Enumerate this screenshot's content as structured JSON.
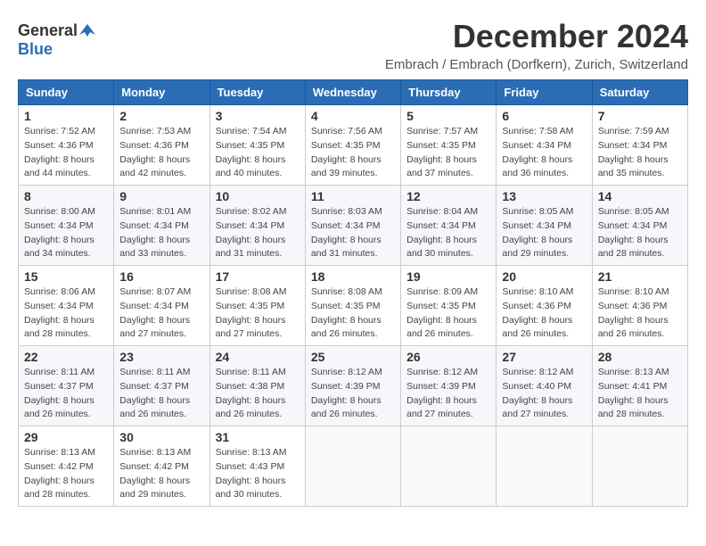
{
  "header": {
    "logo_general": "General",
    "logo_blue": "Blue",
    "month_title": "December 2024",
    "subtitle": "Embrach / Embrach (Dorfkern), Zurich, Switzerland"
  },
  "days_of_week": [
    "Sunday",
    "Monday",
    "Tuesday",
    "Wednesday",
    "Thursday",
    "Friday",
    "Saturday"
  ],
  "weeks": [
    [
      {
        "day": "1",
        "sunrise": "Sunrise: 7:52 AM",
        "sunset": "Sunset: 4:36 PM",
        "daylight": "Daylight: 8 hours and 44 minutes."
      },
      {
        "day": "2",
        "sunrise": "Sunrise: 7:53 AM",
        "sunset": "Sunset: 4:36 PM",
        "daylight": "Daylight: 8 hours and 42 minutes."
      },
      {
        "day": "3",
        "sunrise": "Sunrise: 7:54 AM",
        "sunset": "Sunset: 4:35 PM",
        "daylight": "Daylight: 8 hours and 40 minutes."
      },
      {
        "day": "4",
        "sunrise": "Sunrise: 7:56 AM",
        "sunset": "Sunset: 4:35 PM",
        "daylight": "Daylight: 8 hours and 39 minutes."
      },
      {
        "day": "5",
        "sunrise": "Sunrise: 7:57 AM",
        "sunset": "Sunset: 4:35 PM",
        "daylight": "Daylight: 8 hours and 37 minutes."
      },
      {
        "day": "6",
        "sunrise": "Sunrise: 7:58 AM",
        "sunset": "Sunset: 4:34 PM",
        "daylight": "Daylight: 8 hours and 36 minutes."
      },
      {
        "day": "7",
        "sunrise": "Sunrise: 7:59 AM",
        "sunset": "Sunset: 4:34 PM",
        "daylight": "Daylight: 8 hours and 35 minutes."
      }
    ],
    [
      {
        "day": "8",
        "sunrise": "Sunrise: 8:00 AM",
        "sunset": "Sunset: 4:34 PM",
        "daylight": "Daylight: 8 hours and 34 minutes."
      },
      {
        "day": "9",
        "sunrise": "Sunrise: 8:01 AM",
        "sunset": "Sunset: 4:34 PM",
        "daylight": "Daylight: 8 hours and 33 minutes."
      },
      {
        "day": "10",
        "sunrise": "Sunrise: 8:02 AM",
        "sunset": "Sunset: 4:34 PM",
        "daylight": "Daylight: 8 hours and 31 minutes."
      },
      {
        "day": "11",
        "sunrise": "Sunrise: 8:03 AM",
        "sunset": "Sunset: 4:34 PM",
        "daylight": "Daylight: 8 hours and 31 minutes."
      },
      {
        "day": "12",
        "sunrise": "Sunrise: 8:04 AM",
        "sunset": "Sunset: 4:34 PM",
        "daylight": "Daylight: 8 hours and 30 minutes."
      },
      {
        "day": "13",
        "sunrise": "Sunrise: 8:05 AM",
        "sunset": "Sunset: 4:34 PM",
        "daylight": "Daylight: 8 hours and 29 minutes."
      },
      {
        "day": "14",
        "sunrise": "Sunrise: 8:05 AM",
        "sunset": "Sunset: 4:34 PM",
        "daylight": "Daylight: 8 hours and 28 minutes."
      }
    ],
    [
      {
        "day": "15",
        "sunrise": "Sunrise: 8:06 AM",
        "sunset": "Sunset: 4:34 PM",
        "daylight": "Daylight: 8 hours and 28 minutes."
      },
      {
        "day": "16",
        "sunrise": "Sunrise: 8:07 AM",
        "sunset": "Sunset: 4:34 PM",
        "daylight": "Daylight: 8 hours and 27 minutes."
      },
      {
        "day": "17",
        "sunrise": "Sunrise: 8:08 AM",
        "sunset": "Sunset: 4:35 PM",
        "daylight": "Daylight: 8 hours and 27 minutes."
      },
      {
        "day": "18",
        "sunrise": "Sunrise: 8:08 AM",
        "sunset": "Sunset: 4:35 PM",
        "daylight": "Daylight: 8 hours and 26 minutes."
      },
      {
        "day": "19",
        "sunrise": "Sunrise: 8:09 AM",
        "sunset": "Sunset: 4:35 PM",
        "daylight": "Daylight: 8 hours and 26 minutes."
      },
      {
        "day": "20",
        "sunrise": "Sunrise: 8:10 AM",
        "sunset": "Sunset: 4:36 PM",
        "daylight": "Daylight: 8 hours and 26 minutes."
      },
      {
        "day": "21",
        "sunrise": "Sunrise: 8:10 AM",
        "sunset": "Sunset: 4:36 PM",
        "daylight": "Daylight: 8 hours and 26 minutes."
      }
    ],
    [
      {
        "day": "22",
        "sunrise": "Sunrise: 8:11 AM",
        "sunset": "Sunset: 4:37 PM",
        "daylight": "Daylight: 8 hours and 26 minutes."
      },
      {
        "day": "23",
        "sunrise": "Sunrise: 8:11 AM",
        "sunset": "Sunset: 4:37 PM",
        "daylight": "Daylight: 8 hours and 26 minutes."
      },
      {
        "day": "24",
        "sunrise": "Sunrise: 8:11 AM",
        "sunset": "Sunset: 4:38 PM",
        "daylight": "Daylight: 8 hours and 26 minutes."
      },
      {
        "day": "25",
        "sunrise": "Sunrise: 8:12 AM",
        "sunset": "Sunset: 4:39 PM",
        "daylight": "Daylight: 8 hours and 26 minutes."
      },
      {
        "day": "26",
        "sunrise": "Sunrise: 8:12 AM",
        "sunset": "Sunset: 4:39 PM",
        "daylight": "Daylight: 8 hours and 27 minutes."
      },
      {
        "day": "27",
        "sunrise": "Sunrise: 8:12 AM",
        "sunset": "Sunset: 4:40 PM",
        "daylight": "Daylight: 8 hours and 27 minutes."
      },
      {
        "day": "28",
        "sunrise": "Sunrise: 8:13 AM",
        "sunset": "Sunset: 4:41 PM",
        "daylight": "Daylight: 8 hours and 28 minutes."
      }
    ],
    [
      {
        "day": "29",
        "sunrise": "Sunrise: 8:13 AM",
        "sunset": "Sunset: 4:42 PM",
        "daylight": "Daylight: 8 hours and 28 minutes."
      },
      {
        "day": "30",
        "sunrise": "Sunrise: 8:13 AM",
        "sunset": "Sunset: 4:42 PM",
        "daylight": "Daylight: 8 hours and 29 minutes."
      },
      {
        "day": "31",
        "sunrise": "Sunrise: 8:13 AM",
        "sunset": "Sunset: 4:43 PM",
        "daylight": "Daylight: 8 hours and 30 minutes."
      },
      null,
      null,
      null,
      null
    ]
  ]
}
